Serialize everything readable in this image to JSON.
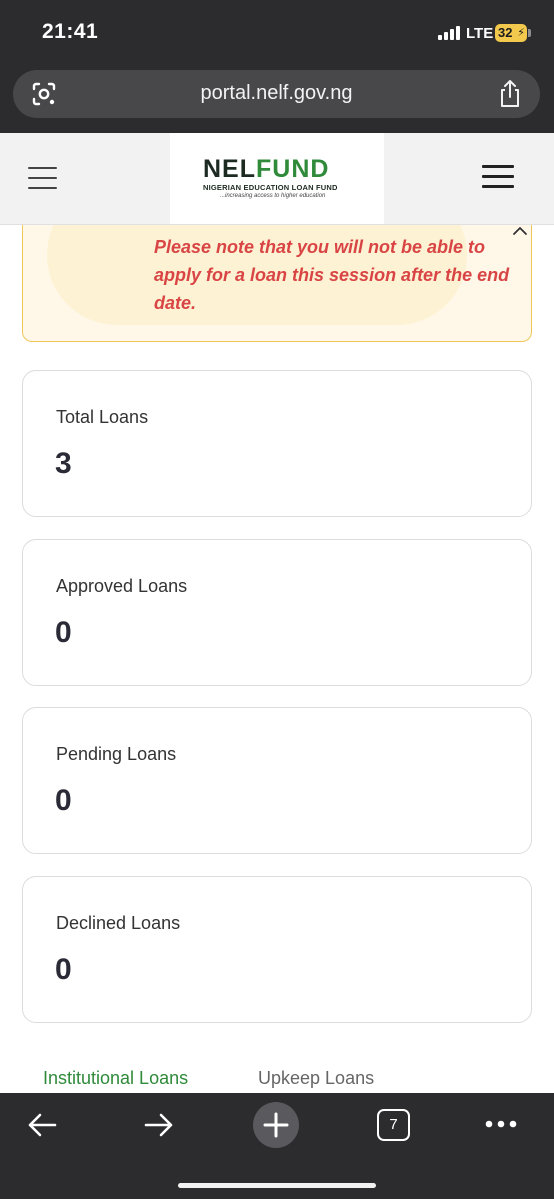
{
  "status_bar": {
    "time": "21:41",
    "network": "LTE",
    "battery": "32"
  },
  "browser": {
    "url": "portal.nelf.gov.ng",
    "tab_count": "7"
  },
  "header": {
    "logo": {
      "word_a": "NEL",
      "word_b": "FUND",
      "subtitle": "NIGERIAN EDUCATION LOAN FUND",
      "tagline": "...increasing access to higher education"
    }
  },
  "notice": {
    "message": "Please note that you will not be able to apply for a loan this session after the end date."
  },
  "stats": [
    {
      "label": "Total Loans",
      "value": "3"
    },
    {
      "label": "Approved Loans",
      "value": "0"
    },
    {
      "label": "Pending Loans",
      "value": "0"
    },
    {
      "label": "Declined Loans",
      "value": "0"
    }
  ],
  "tabs": [
    {
      "label": "Institutional Loans",
      "active": true
    },
    {
      "label": "Upkeep Loans",
      "active": false
    }
  ],
  "colors": {
    "brand_green": "#2f8a3a",
    "notice_red": "#d94545",
    "notice_bg": "#fff8e8",
    "chrome_dark": "#2c2c2e"
  },
  "icons": [
    "lens-icon",
    "share-icon",
    "menu-icon",
    "chevron-up-icon",
    "back-arrow-icon",
    "forward-arrow-icon",
    "new-tab-plus-icon",
    "tabs-icon",
    "more-icon"
  ]
}
